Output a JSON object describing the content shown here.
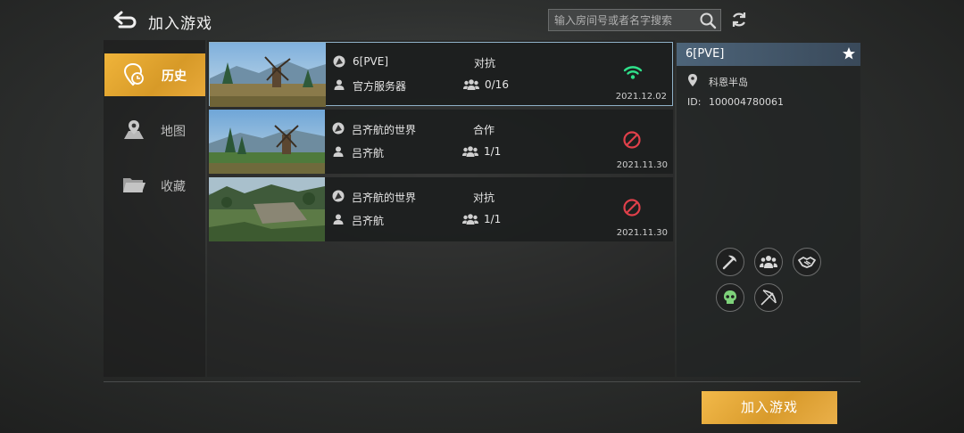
{
  "header": {
    "title": "加入游戏",
    "search_placeholder": "输入房间号或者名字搜索"
  },
  "sidebar": {
    "items": [
      {
        "label": "历史",
        "icon": "clock-pin-icon",
        "active": true
      },
      {
        "label": "地图",
        "icon": "map-icon",
        "active": false
      },
      {
        "label": "收藏",
        "icon": "folder-icon",
        "active": false
      }
    ]
  },
  "servers": [
    {
      "name": "6[PVE]",
      "owner": "官方服务器",
      "mode": "对抗",
      "players": "0/16",
      "date": "2021.12.02",
      "status": "online",
      "status_icon": "wifi-icon",
      "selected": true
    },
    {
      "name": "吕齐航的世界",
      "owner": "吕齐航",
      "mode": "合作",
      "players": "1/1",
      "date": "2021.11.30",
      "status": "unavailable",
      "status_icon": "no-entry-icon",
      "selected": false
    },
    {
      "name": "吕齐航的世界",
      "owner": "吕齐航",
      "mode": "对抗",
      "players": "1/1",
      "date": "2021.11.30",
      "status": "unavailable",
      "status_icon": "no-entry-icon",
      "selected": false
    }
  ],
  "detail": {
    "title": "6[PVE]",
    "map": "科恩半岛",
    "id_label": "ID:",
    "id_value": "100004780061",
    "mode_icons": [
      "pickaxe-icon",
      "group-icon",
      "handshake-icon",
      "skull-icon",
      "bow-icon"
    ]
  },
  "footer": {
    "join_label": "加入游戏"
  },
  "colors": {
    "accent": "#e8a93a",
    "online": "#2fe08a",
    "unavailable": "#e0404a",
    "selected_border": "#8fb1c8"
  }
}
